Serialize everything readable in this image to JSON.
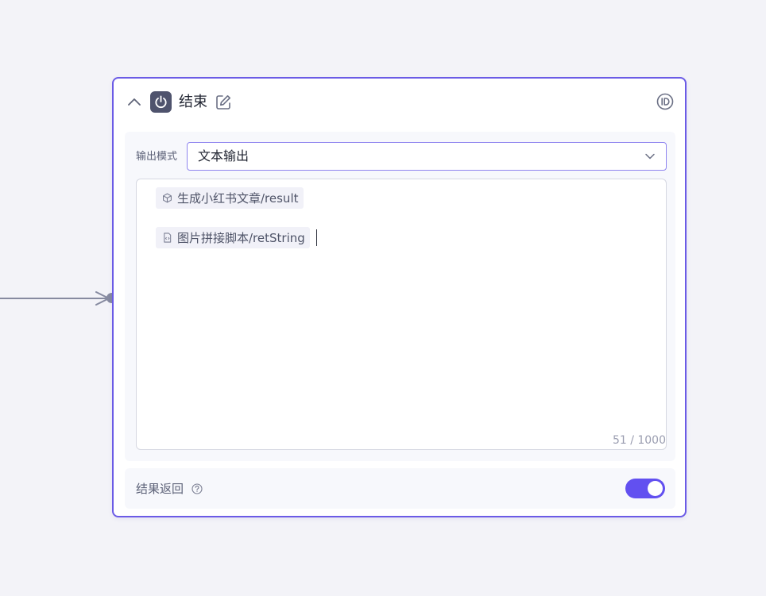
{
  "node": {
    "title": "结束",
    "title_icon": "power-icon",
    "accent_color": "#6b5be6"
  },
  "output": {
    "mode_label": "输出模式",
    "mode_value": "文本输出"
  },
  "editor": {
    "variables": [
      {
        "icon": "cube-icon",
        "label": "生成小红书文章/result"
      },
      {
        "icon": "script-file-icon",
        "label": "图片拼接脚本/retString"
      }
    ],
    "char_count": "51 / 1000"
  },
  "footer": {
    "label": "结果返回",
    "toggle_on": true,
    "toggle_color": "#6250f0"
  }
}
